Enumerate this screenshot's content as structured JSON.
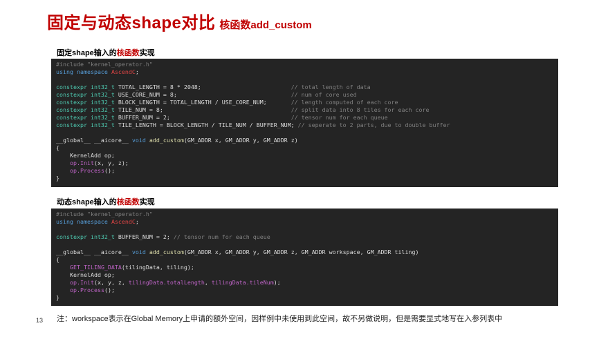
{
  "slide": {
    "title": "固定与动态shape对比",
    "subtitle": "核函数add_custom",
    "page_number": "13",
    "note": "注：workspace表示在Global Memory上申请的额外空间，因样例中未使用到此空间，故不另做说明，但是需要显式地写在入参列表中"
  },
  "fixed_section": {
    "label_prefix": "固定shape输入的",
    "label_highlight": "核函数",
    "label_suffix": "实现",
    "code": {
      "include": "#include \"kernel_operator.h\"",
      "using_kw": "using namespace",
      "using_ns": "AscendC",
      "using_end": ";",
      "decl_kw": "constexpr int32_t",
      "consts": [
        {
          "code": " TOTAL_LENGTH = 8 * 2048;",
          "comment": "// total length of data"
        },
        {
          "code": " USE_CORE_NUM = 8;",
          "comment": "// num of core used"
        },
        {
          "code": " BLOCK_LENGTH = TOTAL_LENGTH / USE_CORE_NUM;",
          "comment": "// length computed of each core"
        },
        {
          "code": " TILE_NUM = 8;",
          "comment": "// split data into 8 tiles for each core"
        },
        {
          "code": " BUFFER_NUM = 2;",
          "comment": "// tensor num for each queue"
        },
        {
          "code": " TILE_LENGTH = BLOCK_LENGTH / TILE_NUM / BUFFER_NUM;",
          "comment": "// seperate to 2 parts, due to double buffer"
        }
      ],
      "sig_qual": "__global__ __aicore__",
      "sig_void": "void",
      "sig_fn": "add_custom",
      "sig_params": "(GM_ADDR x, GM_ADDR y, GM_ADDR z)",
      "open_brace": "{",
      "body_obj": "KernelAdd op;",
      "body_init_obj": "op.",
      "body_init_fn": "Init",
      "body_init_args": "(x, y, z);",
      "body_proc_obj": "op.",
      "body_proc_fn": "Process",
      "body_proc_args": "();",
      "close_brace": "}"
    }
  },
  "dynamic_section": {
    "label_prefix": "动态shape输入的",
    "label_highlight": "核函数",
    "label_suffix": "实现",
    "code": {
      "include": "#include \"kernel_operator.h\"",
      "using_kw": "using namespace",
      "using_ns": "AscendC",
      "using_end": ";",
      "decl_kw": "constexpr int32_t",
      "buffer_decl": " BUFFER_NUM = 2;",
      "buffer_comment": "// tensor num for each queue",
      "sig_qual": "__global__ __aicore__",
      "sig_void": "void",
      "sig_fn": "add_custom",
      "sig_params": "(GM_ADDR x, GM_ADDR y, GM_ADDR z, GM_ADDR workspace, GM_ADDR tiling)",
      "open_brace": "{",
      "tiling_macro": "GET_TILING_DATA",
      "tiling_args": "(tilingData, tiling);",
      "body_obj": "KernelAdd op;",
      "body_init_obj": "op.",
      "body_init_fn": "Init",
      "body_init_args_a": "(x, y, z, ",
      "body_init_arg_total": "tilingData.totalLength",
      "body_init_sep": ", ",
      "body_init_arg_tile": "tilingData.tileNum",
      "body_init_end": ");",
      "body_proc_obj": "op.",
      "body_proc_fn": "Process",
      "body_proc_args": "();",
      "close_brace": "}"
    }
  }
}
